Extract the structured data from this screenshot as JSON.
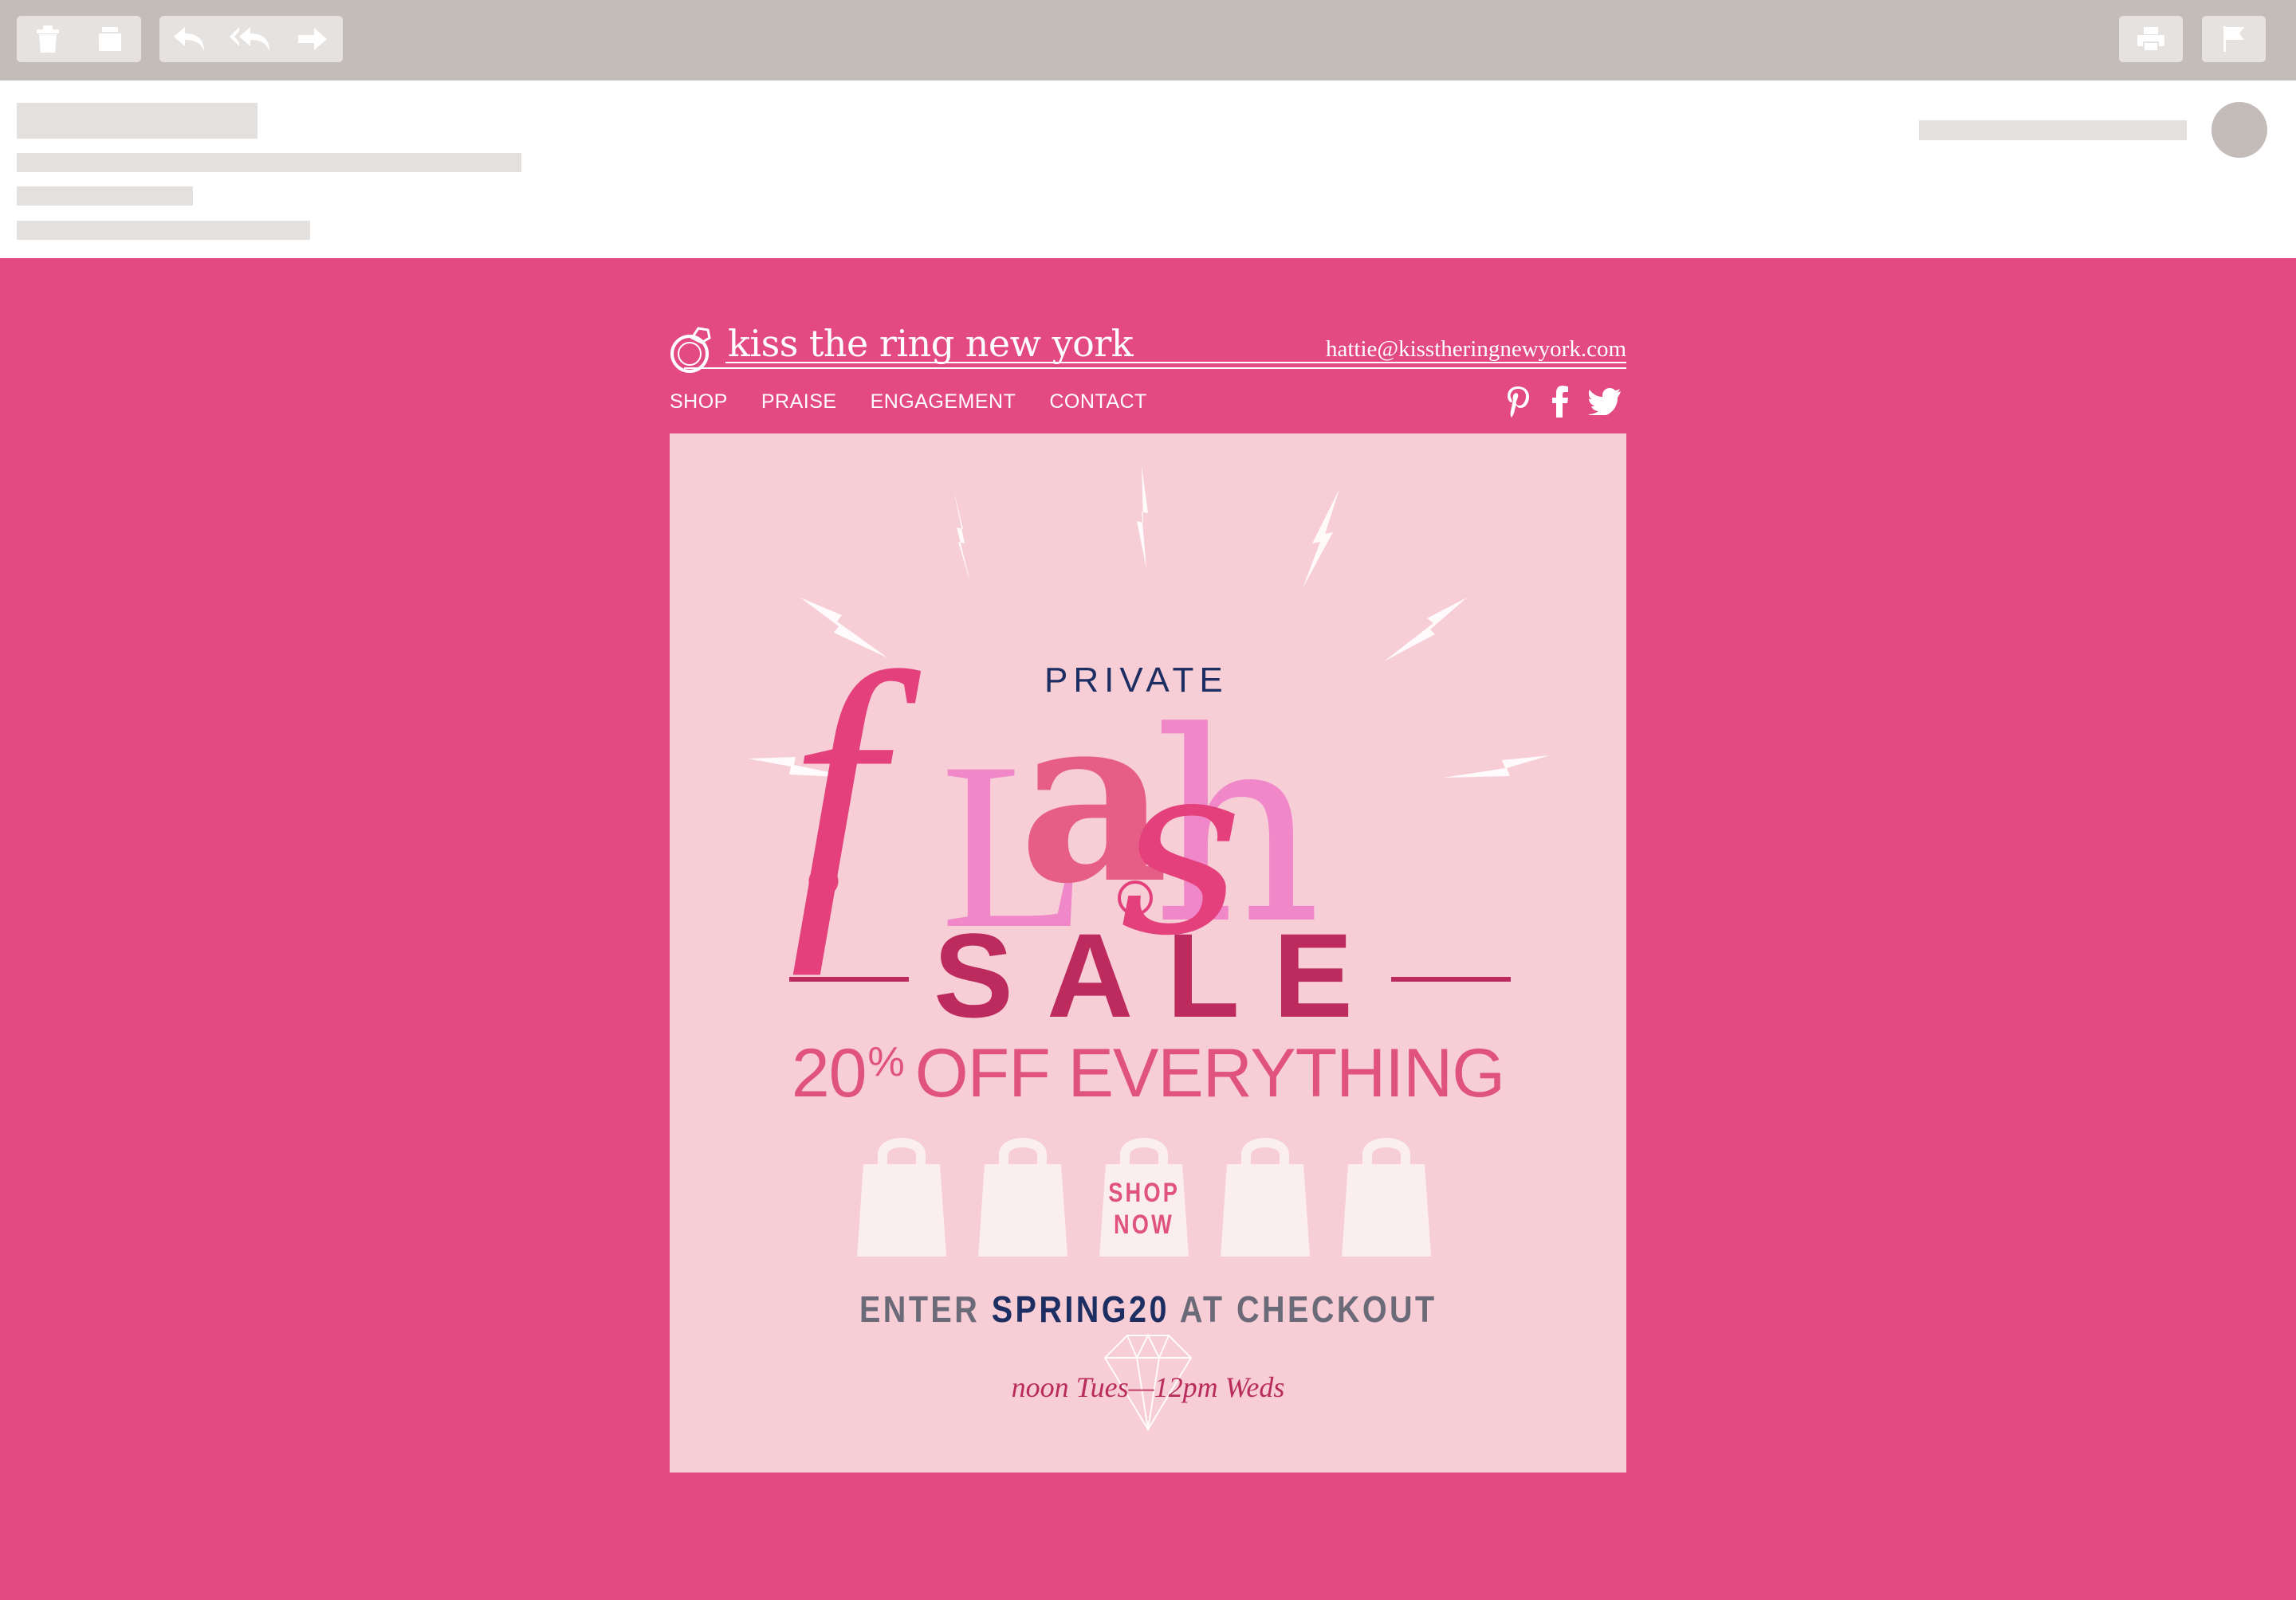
{
  "toolbar": {
    "buttons": [
      "delete-icon",
      "archive-icon",
      "reply-icon",
      "reply-all-icon",
      "forward-icon",
      "print-icon",
      "flag-icon"
    ]
  },
  "email": {
    "brand": {
      "name": "kiss the ring new york",
      "email": "hattie@kisstheringnewyork.com"
    },
    "nav": [
      "SHOP",
      "PRAISE",
      "ENGAGEMENT",
      "CONTACT"
    ],
    "social": [
      "pinterest-icon",
      "facebook-icon",
      "twitter-icon"
    ],
    "hero": {
      "private": "PRIVATE",
      "flash": "flash",
      "sale": "SALE",
      "offer_number": "20",
      "offer_pct": "%",
      "offer_text": "OFF EVERYTHING",
      "shop_now_line1": "SHOP",
      "shop_now_line2": "NOW",
      "code_prefix": "ENTER",
      "code": "SPRING20",
      "code_suffix": "AT CHECKOUT",
      "hours": "noon Tues—12pm Weds"
    },
    "colors": {
      "background": "#e34a82",
      "card": "#f7cdd6",
      "navy": "#1d2f62",
      "sale": "#bd2a5d",
      "offer": "#e0527f"
    }
  }
}
